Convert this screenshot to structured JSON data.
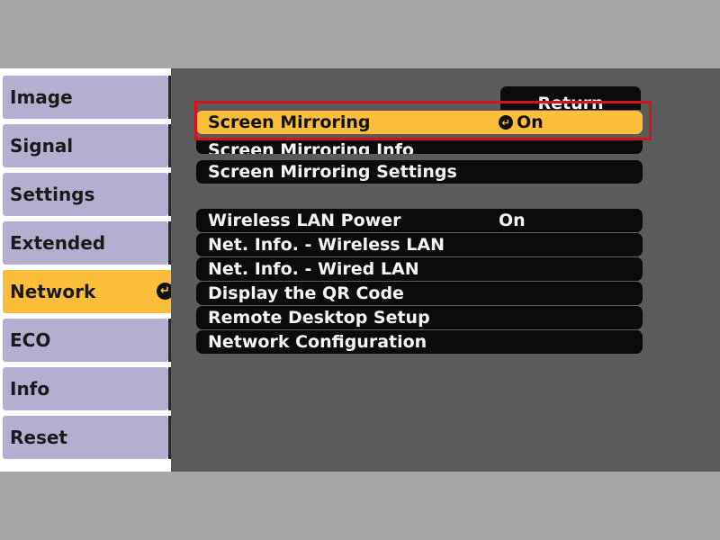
{
  "sidebar": {
    "items": [
      {
        "label": "Image"
      },
      {
        "label": "Signal"
      },
      {
        "label": "Settings"
      },
      {
        "label": "Extended"
      },
      {
        "label": "Network",
        "active": true
      },
      {
        "label": "ECO"
      },
      {
        "label": "Info"
      },
      {
        "label": "Reset"
      }
    ],
    "enter_glyph": "↵"
  },
  "main": {
    "return_label": "Return",
    "group1": [
      {
        "label": "Screen Mirroring",
        "value": "On",
        "selected": true
      },
      {
        "label": "Screen Mirroring Info"
      },
      {
        "label": "Screen Mirroring Settings"
      }
    ],
    "group2": [
      {
        "label": "Wireless LAN Power",
        "value": "On"
      },
      {
        "label": "Net. Info. - Wireless LAN"
      },
      {
        "label": "Net. Info. - Wired LAN"
      },
      {
        "label": "Display the QR Code"
      },
      {
        "label": "Remote Desktop Setup"
      },
      {
        "label": "Network Configuration"
      }
    ]
  },
  "colors": {
    "selected": "#fbbe3a",
    "sidebar_tab": "#b4aed0",
    "panel": "#5b5b5b",
    "highlight": "#d3141c"
  }
}
